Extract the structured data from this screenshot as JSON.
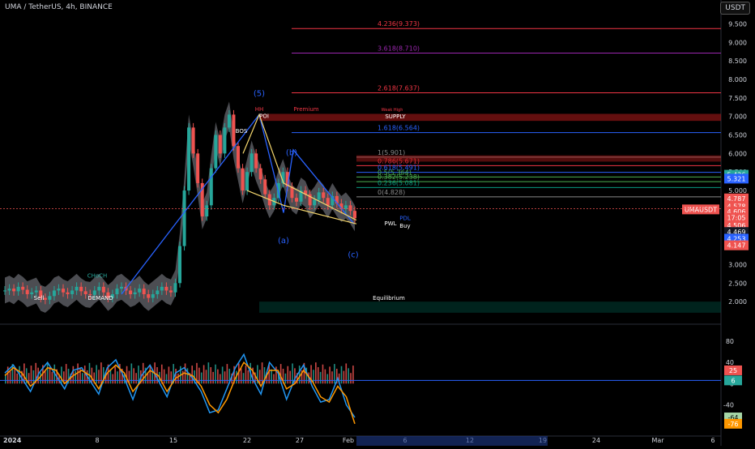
{
  "header": {
    "symbol_line": "UMA / TetherUS, 4h, BINANCE",
    "currency_button": "USDT"
  },
  "colors": {
    "up": "#26a69a",
    "down": "#ef5350",
    "wave": "#2962ff",
    "gold": "#f5d76e",
    "cloud": "#a9abb5",
    "fib_red": "#f23645",
    "fib_purple": "#9c27b0",
    "fib_blue": "#2962ff"
  },
  "chart_data": [
    {
      "type": "candlestick",
      "title": "UMA / TetherUS, 4h, BINANCE",
      "x_ticks": [
        "2024",
        "8",
        "15",
        "22",
        "27",
        "Feb",
        "6",
        "12",
        "19",
        "24",
        "Mar",
        "6"
      ],
      "y_ticks": [
        9.5,
        9.0,
        8.5,
        8.0,
        7.5,
        7.0,
        6.5,
        6.0,
        5.5,
        5.0,
        4.5,
        4.0,
        3.5,
        3.0,
        2.5,
        2.0
      ],
      "ylim": [
        1.5,
        9.75
      ],
      "series_close": [
        2.3,
        2.35,
        2.28,
        2.4,
        2.32,
        2.2,
        2.25,
        2.3,
        2.1,
        2.05,
        2.15,
        2.3,
        2.35,
        2.25,
        2.2,
        2.3,
        2.4,
        2.28,
        2.2,
        2.18,
        2.3,
        2.4,
        2.25,
        2.1,
        2.2,
        2.35,
        2.4,
        2.3,
        2.2,
        2.25,
        2.35,
        2.2,
        2.1,
        2.2,
        2.3,
        2.4,
        2.3,
        2.25,
        2.5,
        3.5,
        5.0,
        6.7,
        6.0,
        5.2,
        4.3,
        4.6,
        5.6,
        6.5,
        6.0,
        6.7,
        7.05,
        6.2,
        5.6,
        5.0,
        5.5,
        6.0,
        5.6,
        5.3,
        4.9,
        4.6,
        4.8,
        5.2,
        5.5,
        5.1,
        4.8,
        4.7,
        5.0,
        4.9,
        4.6,
        4.75,
        4.95,
        4.8,
        4.6,
        4.85,
        4.65,
        4.5,
        4.6,
        4.45,
        4.25
      ],
      "fib_levels": [
        {
          "label": "4.236(9.373)",
          "value": 9.373
        },
        {
          "label": "3.618(8.710)",
          "value": 8.71
        },
        {
          "label": "2.618(7.637)",
          "value": 7.637
        },
        {
          "label": "1.618(6.564)",
          "value": 6.564
        },
        {
          "label": "1(5.901)",
          "value": 5.901
        },
        {
          "label": "0.786(5.671)",
          "value": 5.671
        },
        {
          "label": "0.618(5.491)",
          "value": 5.491
        },
        {
          "label": "0.5(5.364)",
          "value": 5.364
        },
        {
          "label": "0.382(5.238)",
          "value": 5.238
        },
        {
          "label": "0.236(5.081)",
          "value": 5.081
        },
        {
          "label": "0(4.828)",
          "value": 4.828
        }
      ],
      "price_labels": [
        {
          "text": "5.426",
          "value": 5.426,
          "color": "#26a69a"
        },
        {
          "text": "5.321",
          "value": 5.321,
          "color": "#2962ff"
        },
        {
          "text": "4.787",
          "value": 4.787,
          "color": "#ef5350"
        },
        {
          "text": "4.578",
          "value": 4.578,
          "color": "#ef5350"
        },
        {
          "text": "UMAUSDT",
          "value": 4.49,
          "color": "#ef5350"
        },
        {
          "text": "4.606",
          "value": 4.43,
          "color": "#ef5350"
        },
        {
          "text": "17:05",
          "value": 4.27,
          "color": "#ef5350"
        },
        {
          "text": "4.506",
          "value": 4.06,
          "color": "#ef5350"
        },
        {
          "text": "4.469",
          "value": 3.88,
          "color": "#131722"
        },
        {
          "text": "4.253",
          "value": 3.7,
          "color": "#2962ff"
        },
        {
          "text": "4.147",
          "value": 3.52,
          "color": "#ef5350"
        }
      ],
      "wave_labels": [
        "(5)",
        "(b)",
        "(a)",
        "(c)"
      ],
      "annotations": [
        "HH",
        "Premium",
        "Weak High",
        "SUPPLY",
        "POI",
        "BOS",
        "CHoCH",
        "DEMAND",
        "Equilibrium",
        "PWL",
        "PDL",
        "Buy",
        "Sell"
      ]
    },
    {
      "type": "line",
      "title": "oscillator",
      "y_ticks": [
        80,
        40,
        0,
        -40
      ],
      "ylim": [
        -90,
        100
      ],
      "series": [
        {
          "name": "",
          "color": "#2196f3",
          "values": [
            20,
            35,
            10,
            -15,
            20,
            40,
            15,
            -10,
            25,
            30,
            5,
            -20,
            30,
            45,
            10,
            -30,
            15,
            35,
            5,
            -25,
            20,
            30,
            10,
            -15,
            -55,
            -50,
            -10,
            30,
            55,
            10,
            -20,
            40,
            20,
            -30,
            10,
            35,
            -5,
            -35,
            -30,
            10,
            -40,
            -64
          ]
        },
        {
          "name": "",
          "color": "#ff9800",
          "values": [
            15,
            30,
            20,
            -5,
            10,
            30,
            25,
            0,
            15,
            25,
            15,
            -10,
            20,
            35,
            20,
            -15,
            5,
            25,
            15,
            -15,
            10,
            20,
            15,
            -5,
            -40,
            -55,
            -30,
            10,
            40,
            25,
            -5,
            25,
            25,
            -10,
            0,
            25,
            5,
            -25,
            -35,
            -5,
            -25,
            -76
          ]
        }
      ],
      "value_labels": [
        {
          "text": "25",
          "value": 25,
          "color": "#ef5350"
        },
        {
          "text": "6",
          "value": 6,
          "color": "#26a69a"
        },
        {
          "text": "-64",
          "value": -64,
          "color": "#a5d6a7"
        },
        {
          "text": "-76",
          "value": -76,
          "color": "#ff9800"
        }
      ]
    }
  ]
}
